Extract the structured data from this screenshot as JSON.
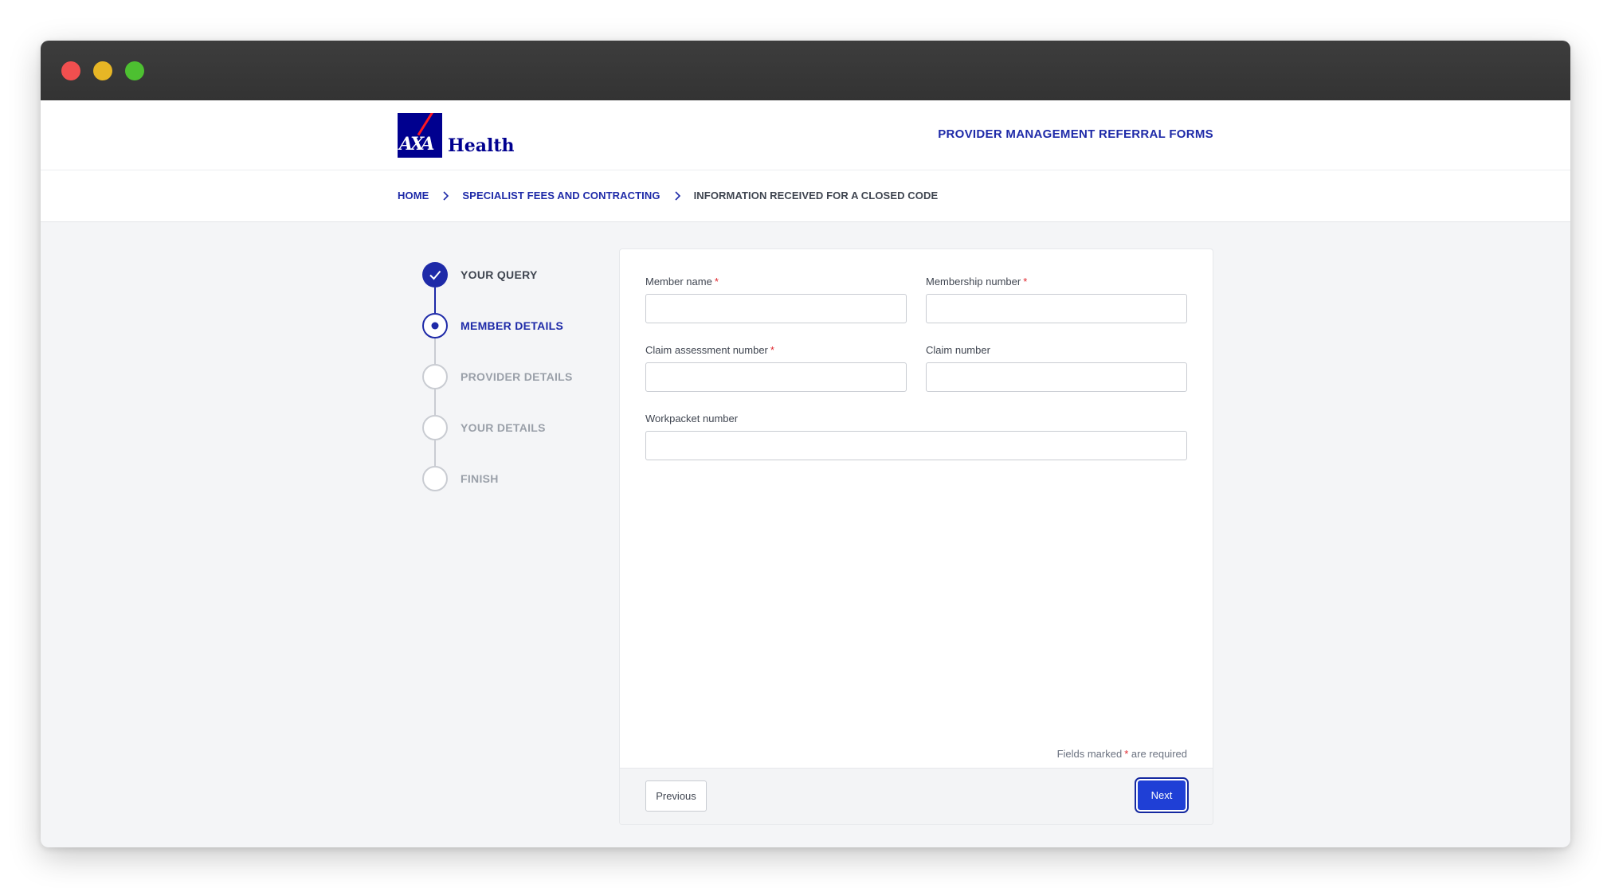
{
  "header": {
    "brand": "Health",
    "brand_mark": "AXA",
    "title": "PROVIDER MANAGEMENT REFERRAL FORMS"
  },
  "breadcrumb": {
    "items": [
      "HOME",
      "SPECIALIST FEES AND CONTRACTING",
      "INFORMATION RECEIVED FOR A CLOSED CODE"
    ]
  },
  "stepper": {
    "steps": [
      {
        "label": "YOUR QUERY",
        "state": "complete"
      },
      {
        "label": "MEMBER DETAILS",
        "state": "current"
      },
      {
        "label": "PROVIDER DETAILS",
        "state": "upcoming"
      },
      {
        "label": "YOUR DETAILS",
        "state": "upcoming"
      },
      {
        "label": "FINISH",
        "state": "upcoming"
      }
    ]
  },
  "form": {
    "fields": {
      "member_name": {
        "label": "Member name",
        "required": true,
        "value": ""
      },
      "membership_number": {
        "label": "Membership number",
        "required": true,
        "value": ""
      },
      "claim_assessment_number": {
        "label": "Claim assessment number",
        "required": true,
        "value": ""
      },
      "claim_number": {
        "label": "Claim number",
        "required": false,
        "value": ""
      },
      "workpacket_number": {
        "label": "Workpacket number",
        "required": false,
        "value": ""
      }
    },
    "required_note_prefix": "Fields marked",
    "required_marker": "*",
    "required_note_suffix": "are required"
  },
  "footer": {
    "previous_label": "Previous",
    "next_label": "Next"
  },
  "colors": {
    "brand_navy": "#00008f",
    "link_blue": "#1e2aa8",
    "accent_red": "#ff1721",
    "primary_button": "#1f3fd6",
    "step_active": "#1e2aa8",
    "step_inactive": "#9aa0a9"
  },
  "icons": {
    "step_complete": "checkmark-icon",
    "step_current": "dot-icon",
    "breadcrumb_separator": "chevron-right-icon"
  }
}
